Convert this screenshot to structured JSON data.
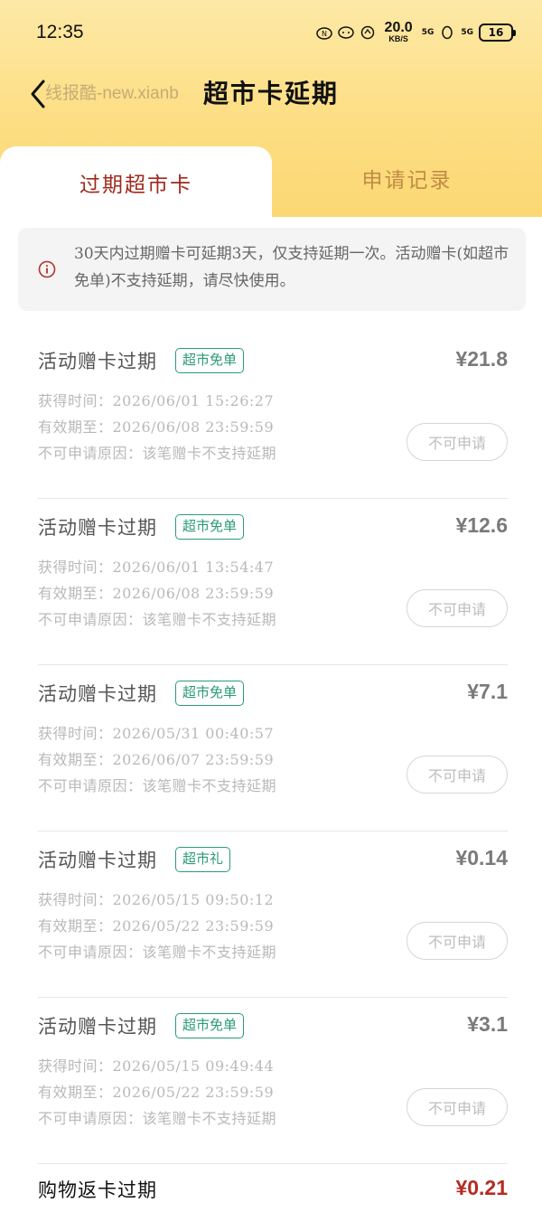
{
  "status_bar": {
    "time": "12:35",
    "speed_value": "20.0",
    "speed_unit": "KB/S",
    "net1": "5G",
    "net2": "5G",
    "battery": "16"
  },
  "nav": {
    "title": "超市卡延期",
    "watermark": "线报酷-new.xianb"
  },
  "tabs": {
    "active": "过期超市卡",
    "inactive": "申请记录"
  },
  "notice": {
    "text": "30天内过期赠卡可延期3天，仅支持延期一次。活动赠卡(如超市免单)不支持延期，请尽快使用。"
  },
  "cards": [
    {
      "title": "活动赠卡过期",
      "tag": "超市免单",
      "amount": "¥21.8",
      "obtained": "获得时间：2026/06/01 15:26:27",
      "valid": "有效期至：2026/06/08 23:59:59",
      "reason": "不可申请原因：该笔赠卡不支持延期",
      "button": "不可申请"
    },
    {
      "title": "活动赠卡过期",
      "tag": "超市免单",
      "amount": "¥12.6",
      "obtained": "获得时间：2026/06/01 13:54:47",
      "valid": "有效期至：2026/06/08 23:59:59",
      "reason": "不可申请原因：该笔赠卡不支持延期",
      "button": "不可申请"
    },
    {
      "title": "活动赠卡过期",
      "tag": "超市免单",
      "amount": "¥7.1",
      "obtained": "获得时间：2026/05/31 00:40:57",
      "valid": "有效期至：2026/06/07 23:59:59",
      "reason": "不可申请原因：该笔赠卡不支持延期",
      "button": "不可申请"
    },
    {
      "title": "活动赠卡过期",
      "tag": "超市礼",
      "amount": "¥0.14",
      "obtained": "获得时间：2026/05/15 09:50:12",
      "valid": "有效期至：2026/05/22 23:59:59",
      "reason": "不可申请原因：该笔赠卡不支持延期",
      "button": "不可申请"
    },
    {
      "title": "活动赠卡过期",
      "tag": "超市免单",
      "amount": "¥3.1",
      "obtained": "获得时间：2026/05/15 09:49:44",
      "valid": "有效期至：2026/05/22 23:59:59",
      "reason": "不可申请原因：该笔赠卡不支持延期",
      "button": "不可申请"
    }
  ],
  "last_card": {
    "title": "购物返卡过期",
    "amount": "¥0.21"
  },
  "colors": {
    "header_gradient_top": "#fde9a6",
    "header_gradient_bottom": "#fbd873",
    "active_tab_text": "#a0291d",
    "inactive_tab_text": "#c08c45",
    "tag_green": "#2a9b73",
    "amount_red": "#b42b22"
  }
}
